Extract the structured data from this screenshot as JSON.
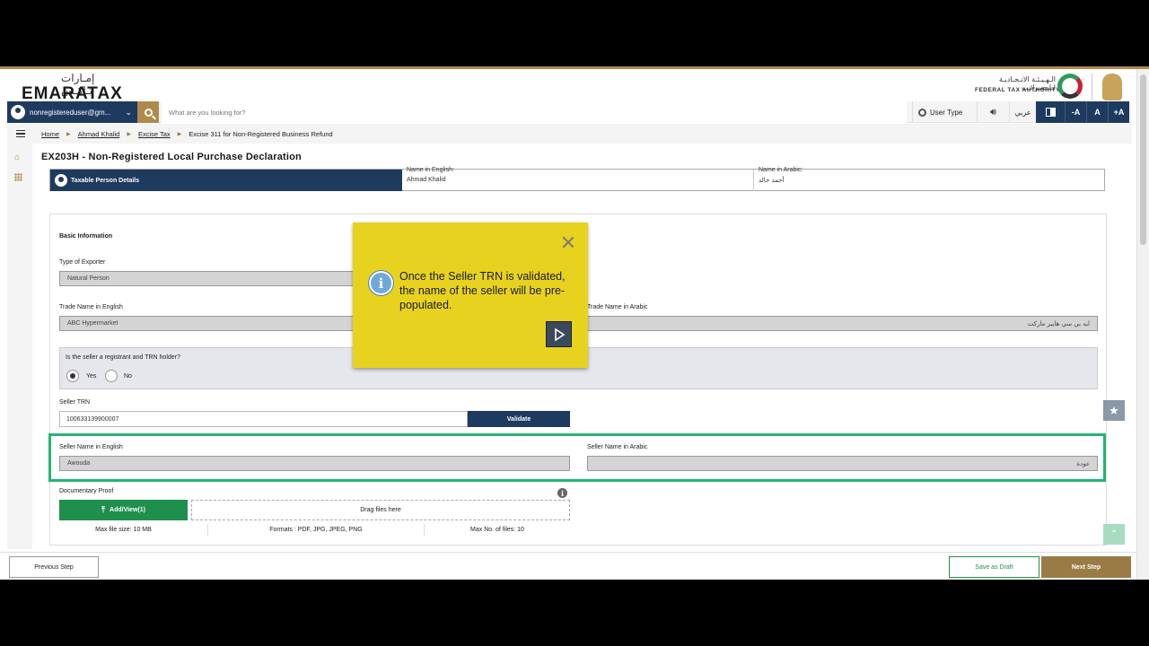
{
  "header": {
    "brand_ar": "إمـارات تـاكـس",
    "brand_en": "EMARATAX",
    "fta_ar": "الـهـيـئـة الاتـحـاديـة لـلـضـرائـب",
    "fta_en": "FEDERAL TAX AUTHORITY"
  },
  "topbar": {
    "user": "nonregistereduser@gm...",
    "search_placeholder": "What are you looking for?",
    "user_type": "User Type",
    "language": "عربي",
    "font_decrease": "-A",
    "font_reset": "A",
    "font_increase": "+A"
  },
  "breadcrumb": {
    "items": [
      "Home",
      "Ahmad Khalid",
      "Excise Tax"
    ],
    "current": "Excise 311 for Non-Registered Business Refund"
  },
  "page": {
    "title": "EX203H - Non-Registered Local Purchase Declaration"
  },
  "taxable_person": {
    "tab_label": "Taxable Person Details",
    "name_en_label": "Name in English:",
    "name_en": "Ahmad Khalid",
    "name_ar_label": "Name in Arabic:",
    "name_ar": "أحمد خالد"
  },
  "form": {
    "section_title": "Basic Information",
    "exporter_type_label": "Type of Exporter",
    "exporter_type": "Natural Person",
    "trade_name_en_label": "Trade Name in English",
    "trade_name_en": "ABC Hypermarket",
    "trade_name_ar_label": "Trade Name in Arabic",
    "trade_name_ar": "ايه بي سي هايبر ماركت",
    "registrant_question": "Is the seller a registrant and TRN holder?",
    "option_yes": "Yes",
    "option_no": "No",
    "selected_option": "Yes",
    "seller_trn_label": "Seller TRN",
    "seller_trn": "100633139900007",
    "validate_label": "Validate",
    "seller_name_en_label": "Seller Name in English",
    "seller_name_en": "Awouda",
    "seller_name_ar_label": "Seller Name in Arabic",
    "seller_name_ar": "عودة",
    "doc_proof_label": "Documentary Proof",
    "add_view_label": "Add/View(1)",
    "drag_label": "Drag files here",
    "max_file_size": "Max file size: 10 MB",
    "formats": "Formats : PDF, JPG, JPEG, PNG",
    "max_files": "Max No. of files: 10"
  },
  "footer": {
    "previous": "Previous Step",
    "save_draft": "Save as Draft",
    "next": "Next Step"
  },
  "callout": {
    "message": "Once the Seller TRN is validated, the name of the seller will be pre-populated."
  },
  "colors": {
    "navy": "#1e3a5f",
    "gold": "#b08a4a",
    "green": "#1f8f4e",
    "highlight": "#22b573",
    "callout": "#e7d21f"
  }
}
